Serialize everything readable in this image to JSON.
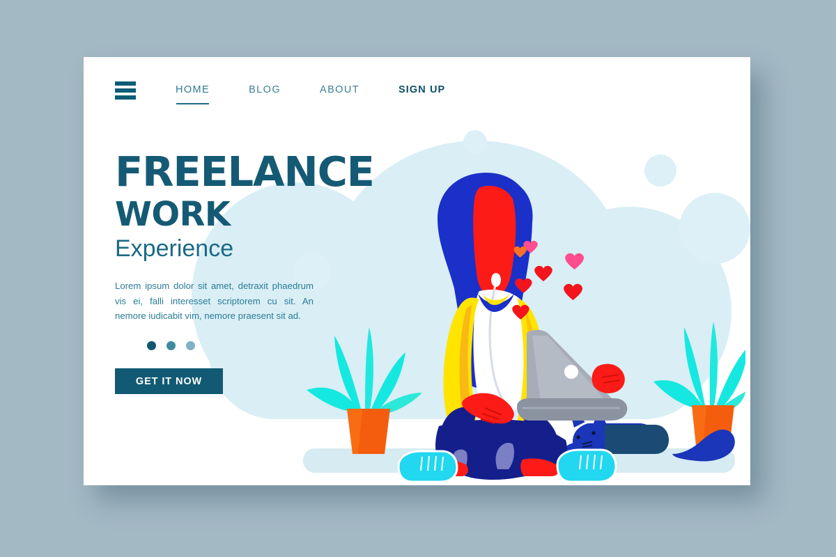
{
  "theme": {
    "outer_background": "#a3b9c4",
    "card_background": "#ffffff",
    "brand_teal": "#155a74",
    "nav_teal": "#3d8196",
    "nav_active_teal": "#2e7a92",
    "nav_strong_teal": "#0c4f68",
    "paragraph_teal": "#2a7c97",
    "cta_background": "#125a73",
    "cta_text": "#ffffff",
    "blob_blue": "#d9eef5",
    "deco_circle_blue": "#ddf0f7",
    "ground_blue": "#d6ebf2"
  },
  "nav": {
    "menu_icon": "hamburger-icon",
    "items": [
      {
        "label": "HOME",
        "state": "active"
      },
      {
        "label": "BLOG",
        "state": "default"
      },
      {
        "label": "ABOUT",
        "state": "default"
      },
      {
        "label": "SIGN UP",
        "state": "emphasis"
      }
    ]
  },
  "hero": {
    "title_line_1": "FREELANCE",
    "title_line_2": "WORK",
    "title_line_3": "Experience",
    "paragraph": "Lorem ipsum dolor sit amet, detraxit phaedrum vis ei, falli interesset scriptorem cu sit. An nemore iudicabit vim, nemore praesent sit ad.",
    "carousel_dots": [
      {
        "index": 1,
        "color": "#12566f",
        "state": "active"
      },
      {
        "index": 2,
        "color": "#3d8ba1",
        "state": "inactive"
      },
      {
        "index": 3,
        "color": "#7fb2c4",
        "state": "inactive"
      }
    ],
    "cta_label": "GET IT NOW"
  },
  "illustration": {
    "name": "woman-working-on-laptop-with-cat-and-plants",
    "elements": [
      "background-cloud-blob",
      "floating-decorative-circles",
      "potted-plant-left",
      "potted-plant-right",
      "seated-woman-with-laptop",
      "floating-hearts",
      "sleeping-cat",
      "ground-shadow-bar"
    ],
    "colors": {
      "hair_blue": "#1b30c8",
      "skin_red": "#fc1b16",
      "jacket_yellow": "#ffe400",
      "jacket_shadow": "#f5ab1b",
      "shirt_white": "#ffffff",
      "pants_navy": "#141f8c",
      "shoe_cyan": "#22d7f0",
      "sock_red": "#fc1b16",
      "laptop_grey": "#a7adb8",
      "laptop_grey_dark": "#8b93a1",
      "cat_blue": "#1b36b8",
      "cat_body_dark": "#1b4a74",
      "plant_leaf_cyan": "#15e8e0",
      "plant_pot_orange": "#f45d0e",
      "heart_red": "#f4141c",
      "heart_pink": "#ff4d8f"
    },
    "heart_count": 7
  }
}
